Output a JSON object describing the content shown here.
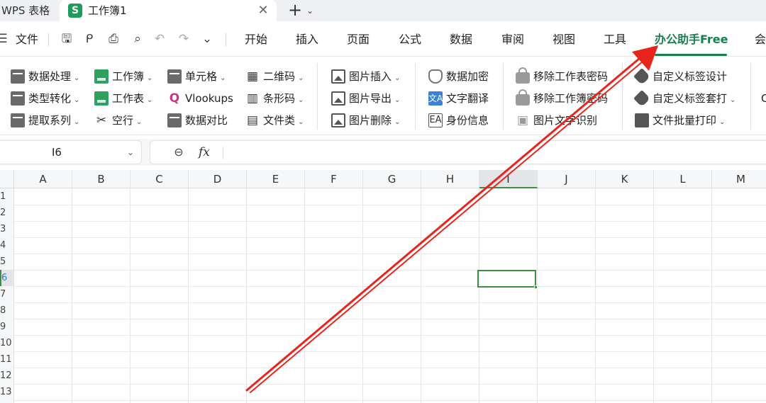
{
  "titlebar": {
    "app_name": "WPS 表格",
    "doc_tab": {
      "icon_letter": "S",
      "name": "工作簿1",
      "close": "✕"
    },
    "new_tab": "+",
    "tab_menu": "⌄"
  },
  "menubar": {
    "file_label": "文件",
    "tabs": [
      "开始",
      "插入",
      "页面",
      "公式",
      "数据",
      "审阅",
      "视图",
      "工具",
      "办公助手Free",
      "会"
    ],
    "active_tab": "办公助手Free"
  },
  "ribbon": {
    "groups": [
      {
        "items": [
          "数据处理",
          "类型转化",
          "提取系列"
        ]
      },
      {
        "items": [
          "工作簿",
          "工作表",
          "空行"
        ]
      },
      {
        "items": [
          "单元格",
          "Vlookups",
          "数据对比"
        ]
      },
      {
        "items": [
          "二维码",
          "条形码",
          "文件类"
        ]
      },
      {
        "items": [
          "图片插入",
          "图片导出",
          "图片删除"
        ]
      },
      {
        "items": [
          "数据加密",
          "文字翻译",
          "身份信息"
        ]
      },
      {
        "items": [
          "移除工作表密码",
          "移除工作簿密码",
          "图片文字识别"
        ]
      },
      {
        "items": [
          "自定义标签设计",
          "自定义标签套打",
          "文件批量打印"
        ]
      }
    ],
    "overflow_char": "C"
  },
  "formula_bar": {
    "cell_ref": "I6",
    "fx_label": "fx",
    "formula": ""
  },
  "grid": {
    "columns": [
      "A",
      "B",
      "C",
      "D",
      "E",
      "F",
      "G",
      "H",
      "I",
      "J",
      "K",
      "L",
      "M"
    ],
    "rows": [
      "1",
      "2",
      "3",
      "4",
      "5",
      "6",
      "7",
      "8",
      "9",
      "10",
      "11",
      "12",
      "13"
    ],
    "active_column": "I",
    "active_row": "6"
  },
  "annotation": {
    "color": "#e8251c"
  }
}
